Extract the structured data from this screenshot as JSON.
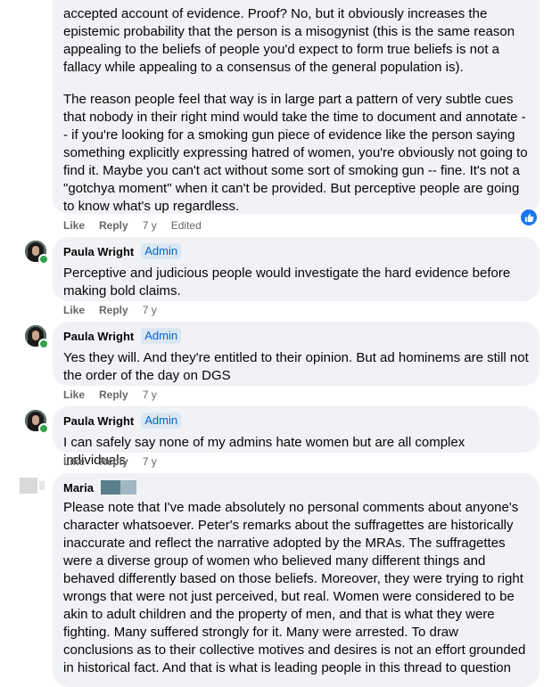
{
  "comment1": {
    "paragraph1": "accepted account of evidence. Proof? No, but it obviously increases the epistemic probability that the person is a misogynist (this is the same reason appealing to the beliefs of people you'd expect to form true beliefs is not a fallacy while appealing to a consensus of the general population is).",
    "paragraph2": "The reason people feel that way is in large part a pattern of very subtle cues that nobody in their right mind would take the time to document and annotate -- if you're looking for a smoking gun piece of evidence like the person saying something explicitly expressing hatred of women, you're obviously not going to find it. Maybe you can't act without some sort of smoking gun -- fine. It's not a \"gotchya moment\" when it can't be provided. But perceptive people are going to know what's up regardless.",
    "like": "Like",
    "reply": "Reply",
    "time": "7 y",
    "edited": "Edited"
  },
  "comment2": {
    "author": "Paula Wright",
    "badge": "Admin",
    "text": "Perceptive and judicious people would investigate the hard evidence before making bold claims.",
    "like": "Like",
    "reply": "Reply",
    "time": "7 y"
  },
  "comment3": {
    "author": "Paula Wright",
    "badge": "Admin",
    "text": "Yes they will. And they're entitled to their opinion. But ad hominems are still not the order of the day on DGS",
    "like": "Like",
    "reply": "Reply",
    "time": "7 y"
  },
  "comment4": {
    "author": "Paula Wright",
    "badge": "Admin",
    "text": "I can safely say none of my admins hate women but are all complex individuals",
    "like": "Like",
    "reply": "Reply",
    "time": "7 y"
  },
  "comment5": {
    "author": "Maria",
    "text": "Please note that I've made absolutely no personal comments about anyone's character whatsoever. Peter's remarks about the suffragettes are historically inaccurate and reflect the narrative adopted by the MRAs. The suffragettes were a diverse group of women who believed many different things and behaved differently based on those beliefs. Moreover, they were trying to right wrongs that were not just perceived, but real. Women were considered to be akin to adult children and the property of men, and that is what they were fighting. Many suffered strongly for it. Many were arrested. To draw conclusions as to their collective motives and desires is not an effort grounded in historical fact. And that is what is leading people in this thread to question"
  },
  "colors": {
    "bubble": "#f0f2f5",
    "accent": "#1877f2",
    "online": "#31a24c",
    "muted": "#65676b"
  }
}
